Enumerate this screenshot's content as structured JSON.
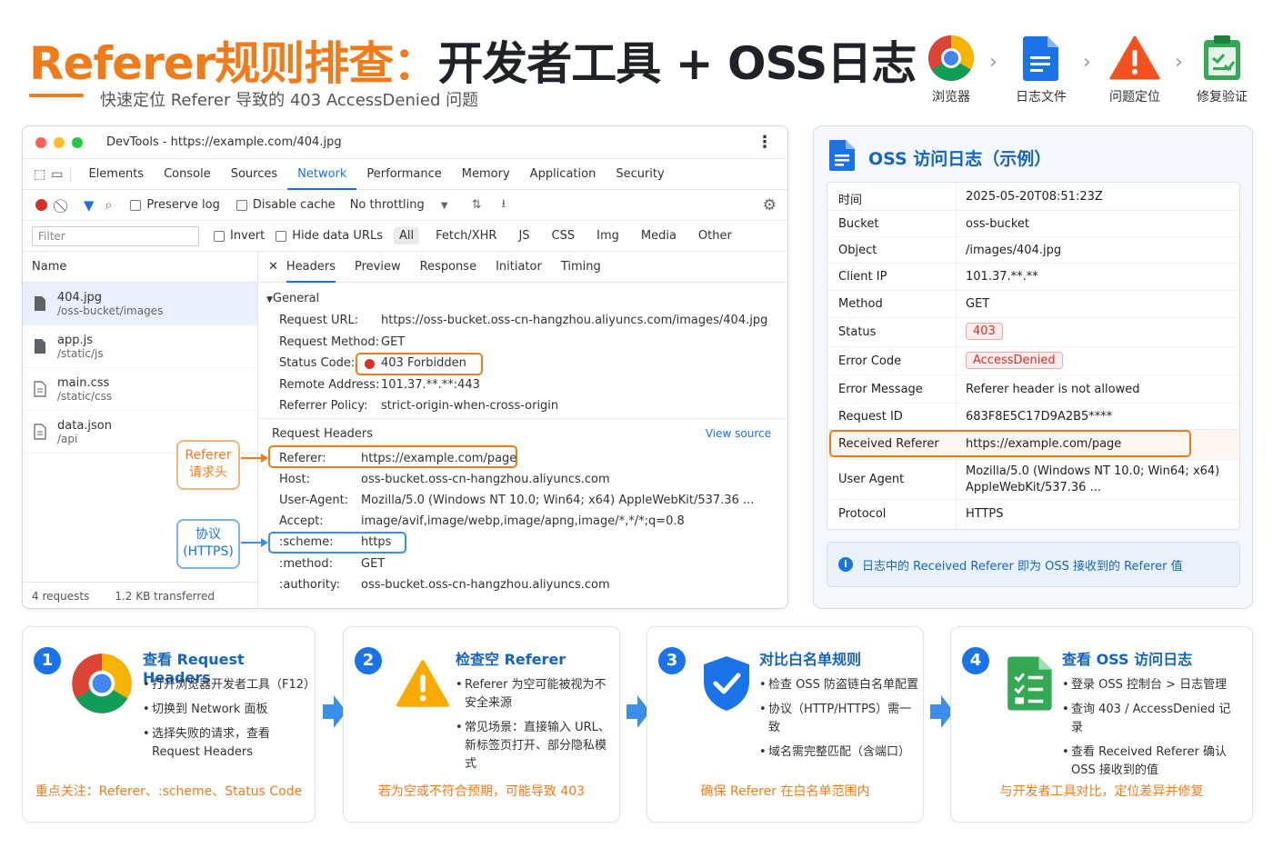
{
  "header": {
    "title_accent": "Referer规则排查：",
    "title_main": "开发者工具 + OSS日志",
    "subtitle": "快速定位 Referer 导致的 403 AccessDenied 问题"
  },
  "flow": [
    {
      "icon": "chrome-icon",
      "label": "浏览器"
    },
    {
      "icon": "log-file-icon",
      "label": "日志文件"
    },
    {
      "icon": "warning-icon",
      "label": "问题定位"
    },
    {
      "icon": "clipboard-check-icon",
      "label": "修复验证"
    }
  ],
  "devtools": {
    "window_title": "DevTools - https://example.com/404.jpg",
    "tabs": [
      "Elements",
      "Console",
      "Sources",
      "Network",
      "Performance",
      "Memory",
      "Application",
      "Security"
    ],
    "active_tab": "Network",
    "toolbar": {
      "preserve_log": "Preserve log",
      "disable_cache": "Disable cache",
      "throttling": "No throttling"
    },
    "filter": {
      "placeholder": "Filter",
      "invert": "Invert",
      "hide_data_urls": "Hide data URLs",
      "types": [
        "All",
        "Fetch/XHR",
        "JS",
        "CSS",
        "Img",
        "Media",
        "Other"
      ]
    },
    "list_header": "Name",
    "requests": [
      {
        "name": "404.jpg",
        "path": "/oss-bucket/images"
      },
      {
        "name": "app.js",
        "path": "/static/js"
      },
      {
        "name": "main.css",
        "path": "/static/css"
      },
      {
        "name": "data.json",
        "path": "/api"
      }
    ],
    "footer": {
      "requests": "4 requests",
      "transferred": "1.2 KB transferred"
    },
    "detail_tabs": [
      "Headers",
      "Preview",
      "Response",
      "Initiator",
      "Timing"
    ],
    "general_title": "General",
    "general": [
      {
        "k": "Request URL:",
        "v": "https://oss-bucket.oss-cn-hangzhou.aliyuncs.com/images/404.jpg"
      },
      {
        "k": "Request Method:",
        "v": "GET"
      },
      {
        "k": "Status Code:",
        "v": "403 Forbidden"
      },
      {
        "k": "Remote Address:",
        "v": "101.37.**.**:443"
      },
      {
        "k": "Referrer Policy:",
        "v": "strict-origin-when-cross-origin"
      }
    ],
    "request_headers_title": "Request Headers",
    "view_source": "View source",
    "request_headers": [
      {
        "k": "Referer:",
        "v": "https://example.com/page"
      },
      {
        "k": "Host:",
        "v": "oss-bucket.oss-cn-hangzhou.aliyuncs.com"
      },
      {
        "k": "User-Agent:",
        "v": "Mozilla/5.0 (Windows NT 10.0; Win64; x64) AppleWebKit/537.36 ..."
      },
      {
        "k": "Accept:",
        "v": "image/avif,image/webp,image/apng,image/*,*/*;q=0.8"
      },
      {
        "k": ":scheme:",
        "v": "https"
      },
      {
        "k": ":method:",
        "v": "GET"
      },
      {
        "k": ":authority:",
        "v": "oss-bucket.oss-cn-hangzhou.aliyuncs.com"
      }
    ],
    "callout_referer": [
      "Referer",
      "请求头"
    ],
    "callout_scheme": [
      "协议",
      "(HTTPS)"
    ]
  },
  "oss": {
    "title": "OSS 访问日志（示例）",
    "rows": [
      {
        "k": "时间",
        "v": "2025-05-20T08:51:23Z"
      },
      {
        "k": "Bucket",
        "v": "oss-bucket"
      },
      {
        "k": "Object",
        "v": "/images/404.jpg"
      },
      {
        "k": "Client IP",
        "v": "101.37.**.**"
      },
      {
        "k": "Method",
        "v": "GET"
      },
      {
        "k": "Status",
        "v": "403"
      },
      {
        "k": "Error Code",
        "v": "AccessDenied"
      },
      {
        "k": "Error Message",
        "v": "Referer header is not allowed"
      },
      {
        "k": "Request ID",
        "v": "683F8E5C17D9A2B5****"
      },
      {
        "k": "Received Referer",
        "v": "https://example.com/page"
      },
      {
        "k": "User Agent",
        "v": "Mozilla/5.0 (Windows NT 10.0; Win64; x64)",
        "v2": "AppleWebKit/537.36 ..."
      },
      {
        "k": "Protocol",
        "v": "HTTPS"
      }
    ],
    "note": "日志中的 Received Referer 即为 OSS 接收到的 Referer 值"
  },
  "steps": [
    {
      "num": "1",
      "icon": "chrome-icon",
      "title": "查看 Request Headers",
      "items": [
        "打开浏览器开发者工具（F12）",
        "切换到 Network 面板",
        "选择失败的请求，查看 Request Headers"
      ],
      "foot": "重点关注：Referer、:scheme、Status Code"
    },
    {
      "num": "2",
      "icon": "warning-icon",
      "title": "检查空 Referer",
      "items": [
        "Referer 为空可能被视为不安全来源",
        "常见场景：直接输入 URL、新标签页打开、部分隐私模式"
      ],
      "foot": "若为空或不符合预期，可能导致 403"
    },
    {
      "num": "3",
      "icon": "shield-check-icon",
      "title": "对比白名单规则",
      "items": [
        "检查 OSS 防盗链白名单配置",
        "协议（HTTP/HTTPS）需一致",
        "域名需完整匹配（含端口）"
      ],
      "foot": "确保 Referer 在白名单范围内"
    },
    {
      "num": "4",
      "icon": "clipboard-list-icon",
      "title": "查看 OSS 访问日志",
      "items": [
        "登录 OSS 控制台 > 日志管理",
        "查询 403 / AccessDenied 记录",
        "查看 Received Referer 确认 OSS 接收到的值"
      ],
      "foot": "与开发者工具对比，定位差异并修复"
    }
  ],
  "colors": {
    "accent": "#f07b1a",
    "brand_blue": "#1a73e8",
    "error": "#d93025"
  }
}
